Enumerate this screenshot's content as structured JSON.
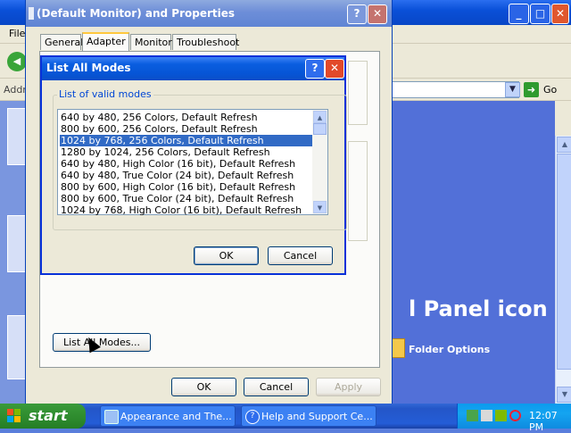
{
  "explorer": {
    "menu_fragment": "File",
    "address_label_fragment": "Address",
    "go_label": "Go",
    "go_icon": "go-arrow-icon",
    "back_icon": "back-arrow-icon",
    "heading_fragment": "l Panel icon",
    "folder_options_label": "Folder Options",
    "controls": {
      "minimize": "_",
      "maximize": "□",
      "close": "✕"
    }
  },
  "properties_dialog": {
    "title": "(Default Monitor) and  Properties",
    "tabs": [
      "General",
      "Adapter",
      "Monitor",
      "Troubleshoot"
    ],
    "active_tab": "Adapter",
    "list_all_modes_button": "List All Modes...",
    "ok_label": "OK",
    "cancel_label": "Cancel",
    "apply_label": "Apply",
    "help_glyph": "?",
    "close_glyph": "✕"
  },
  "modes_dialog": {
    "title": "List All Modes",
    "group_label": "List of valid modes",
    "modes": [
      "640 by 480, 256 Colors, Default Refresh",
      "800 by 600, 256 Colors, Default Refresh",
      "1024 by 768, 256 Colors, Default Refresh",
      "1280 by 1024, 256 Colors, Default Refresh",
      "640 by 480, High Color (16 bit), Default Refresh",
      "640 by 480, True Color (24 bit), Default Refresh",
      "800 by 600, High Color (16 bit), Default Refresh",
      "800 by 600, True Color (24 bit), Default Refresh",
      "1024 by 768, High Color (16 bit), Default Refresh"
    ],
    "selected_index": 2,
    "ok_label": "OK",
    "cancel_label": "Cancel",
    "help_glyph": "?",
    "close_glyph": "✕"
  },
  "taskbar": {
    "start_label": "start",
    "tasks": [
      {
        "label": "Appearance and The...",
        "icon": "control-panel-icon"
      },
      {
        "label": "Help and Support Ce...",
        "icon": "help-icon"
      }
    ],
    "clock": "12:07 PM"
  },
  "colors": {
    "selection": "#316ac5",
    "xp_title_blue": "#0a5ee0",
    "inactive_title": "#7b98dc",
    "group_label": "#0046d5"
  }
}
